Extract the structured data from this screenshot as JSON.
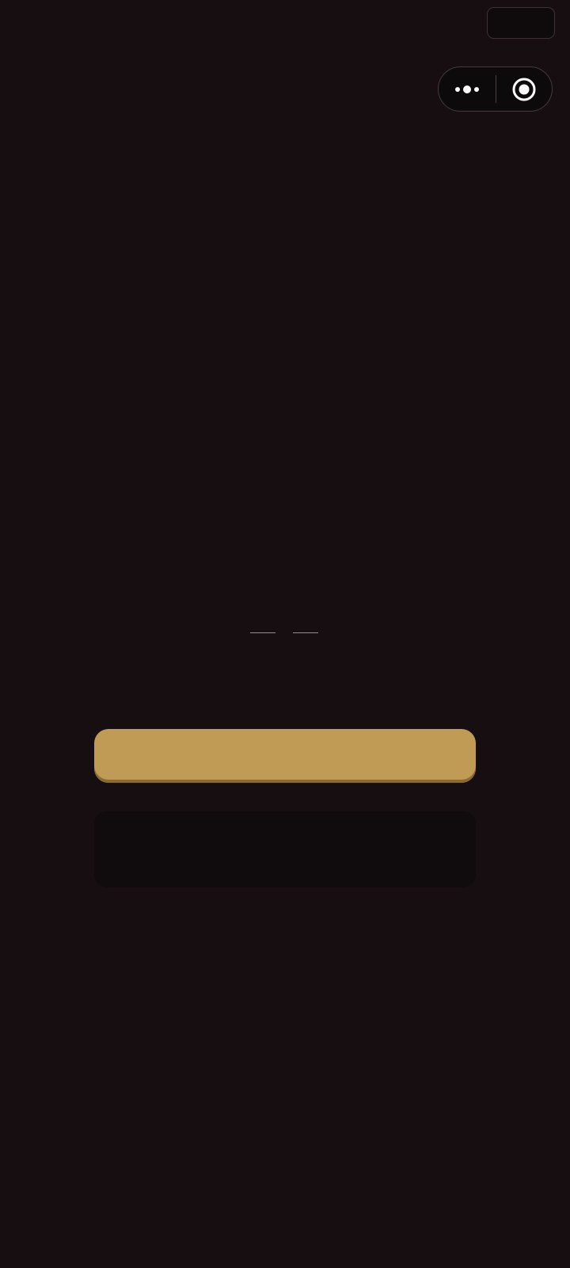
{
  "top_slot": {
    "label": ""
  },
  "capsule": {
    "more_icon": "more-dots-icon",
    "close_icon": "target-close-icon"
  },
  "tabs": [
    {
      "label": ""
    },
    {
      "label": ""
    }
  ],
  "primary_button": {
    "label": ""
  },
  "secondary_button": {
    "label": ""
  },
  "colors": {
    "background": "#170e11",
    "accent_gold": "#bf9b55",
    "secondary_surface": "#100b0d"
  }
}
